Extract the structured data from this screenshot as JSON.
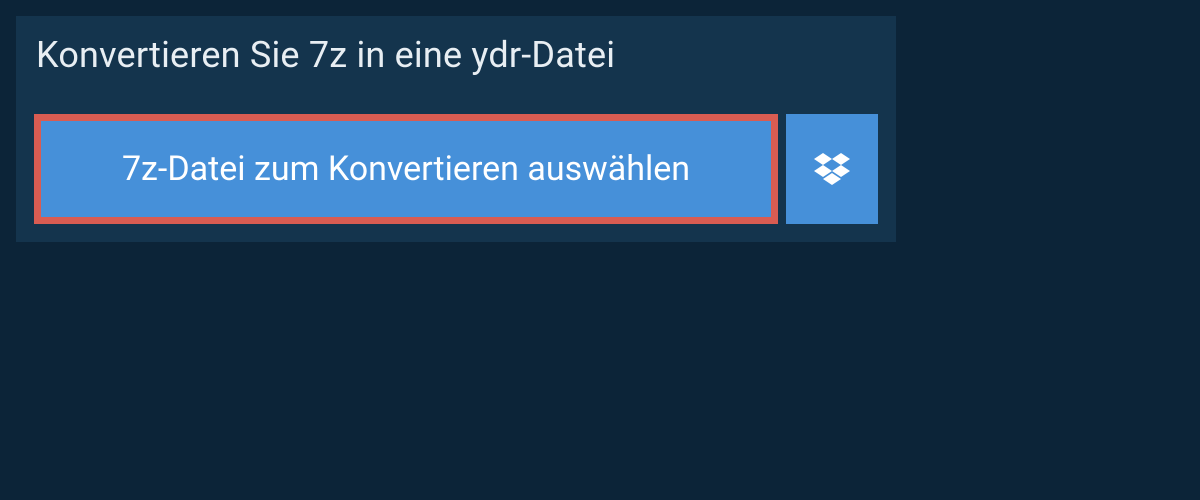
{
  "header": {
    "title": "Konvertieren Sie 7z in eine ydr-Datei"
  },
  "actions": {
    "select_file_label": "7z-Datei zum Konvertieren auswählen",
    "dropbox_icon": "dropbox-icon"
  },
  "colors": {
    "background": "#0c2438",
    "panel": "#14344d",
    "primary_button": "#4690d9",
    "highlight_border": "#d95c52",
    "text_light": "#e8eef3"
  }
}
